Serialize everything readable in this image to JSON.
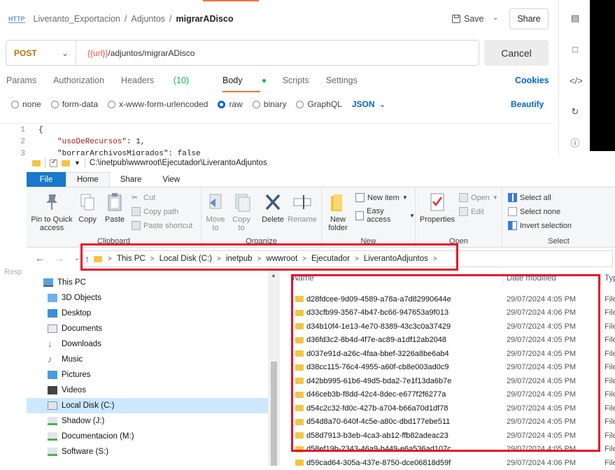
{
  "postman": {
    "breadcrumb": {
      "icon": "HTTP",
      "collection": "Liveranto_Exportacion",
      "folder": "Adjuntos",
      "request": "migrarADisco",
      "sep": "/"
    },
    "save_label": "Save",
    "share_label": "Share",
    "method": "POST",
    "url_var": "{{url}}",
    "url_path": "/adjuntos/migrarADisco",
    "cancel_label": "Cancel",
    "tabs": {
      "params": "Params",
      "authorization": "Authorization",
      "headers": "Headers",
      "headers_count": "(10)",
      "body": "Body",
      "scripts": "Scripts",
      "settings": "Settings"
    },
    "cookies_label": "Cookies",
    "body_types": {
      "none": "none",
      "form_data": "form-data",
      "urlencoded": "x-www-form-urlencoded",
      "raw": "raw",
      "binary": "binary",
      "graphql": "GraphQL"
    },
    "body_format": "JSON",
    "beautify_label": "Beautify",
    "editor": {
      "lines": [
        "1",
        "2",
        "3"
      ],
      "line1": "{",
      "line2_key": "\"usoDeRecursos\"",
      "line2_rest": ": 1,",
      "line3": "\"borrarArchivosMigrados\": false"
    },
    "response_label": "Resp"
  },
  "explorer": {
    "title_path": "C:\\inetpub\\wwwroot\\Ejecutador\\LiverantoAdjuntos",
    "tabs": {
      "file": "File",
      "home": "Home",
      "share": "Share",
      "view": "View"
    },
    "ribbon": {
      "pin": "Pin to Quick access",
      "copy": "Copy",
      "paste": "Paste",
      "cut": "Cut",
      "copy_path": "Copy path",
      "paste_shortcut": "Paste shortcut",
      "clipboard": "Clipboard",
      "move_to": "Move to",
      "copy_to": "Copy to",
      "delete": "Delete",
      "rename": "Rename",
      "organize": "Organize",
      "new_folder": "New folder",
      "new_item": "New item",
      "easy_access": "Easy access",
      "new_group": "New",
      "properties": "Properties",
      "open": "Open",
      "edit": "Edit",
      "open_group": "Open",
      "select_all": "Select all",
      "select_none": "Select none",
      "invert_selection": "Invert selection",
      "select_group": "Select"
    },
    "address": [
      "This PC",
      "Local Disk (C:)",
      "inetpub",
      "wwwroot",
      "Ejecutador",
      "LiverantoAdjuntos"
    ],
    "nav": [
      {
        "label": "This PC",
        "icon": "pc-icon"
      },
      {
        "label": "3D Objects",
        "icon": "3d-objects-icon"
      },
      {
        "label": "Desktop",
        "icon": "desktop-icon"
      },
      {
        "label": "Documents",
        "icon": "documents-icon"
      },
      {
        "label": "Downloads",
        "icon": "downloads-icon"
      },
      {
        "label": "Music",
        "icon": "music-icon"
      },
      {
        "label": "Pictures",
        "icon": "pictures-icon"
      },
      {
        "label": "Videos",
        "icon": "videos-icon"
      },
      {
        "label": "Local Disk (C:)",
        "icon": "disk-icon",
        "selected": true
      },
      {
        "label": "Shadow (J:)",
        "icon": "network-drive-icon"
      },
      {
        "label": "Documentacion (M:)",
        "icon": "network-drive-icon"
      },
      {
        "label": "Software (S:)",
        "icon": "network-drive-icon"
      }
    ],
    "columns": {
      "name": "Name",
      "date": "Date modified",
      "type": "Typ"
    },
    "files": [
      {
        "name": "d28fdcee-9d09-4589-a78a-a7d82990644e",
        "date": "29/07/2024 4:05 PM",
        "type": "File"
      },
      {
        "name": "d33cfb99-3567-4b47-bc66-947653a9f013",
        "date": "29/07/2024 4:06 PM",
        "type": "File"
      },
      {
        "name": "d34b10f4-1e13-4e70-8389-43c3c0a37429",
        "date": "29/07/2024 4:05 PM",
        "type": "File"
      },
      {
        "name": "d36fd3c2-8b4d-4f7e-ac89-a1df12ab2048",
        "date": "29/07/2024 4:05 PM",
        "type": "File"
      },
      {
        "name": "d037e91d-a26c-4faa-bbef-3226a8be6ab4",
        "date": "29/07/2024 4:05 PM",
        "type": "File"
      },
      {
        "name": "d38cc115-76c4-4955-a60f-cb8e003ad0c9",
        "date": "29/07/2024 4:05 PM",
        "type": "File"
      },
      {
        "name": "d42bb995-61b6-49d5-bda2-7e1f13da6b7e",
        "date": "29/07/2024 4:05 PM",
        "type": "File"
      },
      {
        "name": "d46ceb3b-f8dd-42c4-8dec-e677f2f6277a",
        "date": "29/07/2024 4:05 PM",
        "type": "File"
      },
      {
        "name": "d54c2c32-fd0c-427b-a704-b66a70d1df78",
        "date": "29/07/2024 4:05 PM",
        "type": "File"
      },
      {
        "name": "d54d8a70-640f-4c5e-a80c-dbd177ebe511",
        "date": "29/07/2024 4:05 PM",
        "type": "File"
      },
      {
        "name": "d58d7913-b3eb-4ca3-ab12-ffb82adeac23",
        "date": "29/07/2024 4:05 PM",
        "type": "File"
      },
      {
        "name": "d58ef19b-2343-46a9-b449-e6a536ad107c",
        "date": "29/07/2024 4:05 PM",
        "type": "File"
      },
      {
        "name": "d59cad64-305a-437e-8750-dce06818d59f",
        "date": "29/07/2024 4:06 PM",
        "type": "File"
      }
    ]
  },
  "colors": {
    "postman_orange": "#ff6c37",
    "postman_blue": "#0265d2",
    "highlight_red": "#e8112d",
    "explorer_blue": "#1979ca",
    "folder_yellow": "#f1c644"
  }
}
